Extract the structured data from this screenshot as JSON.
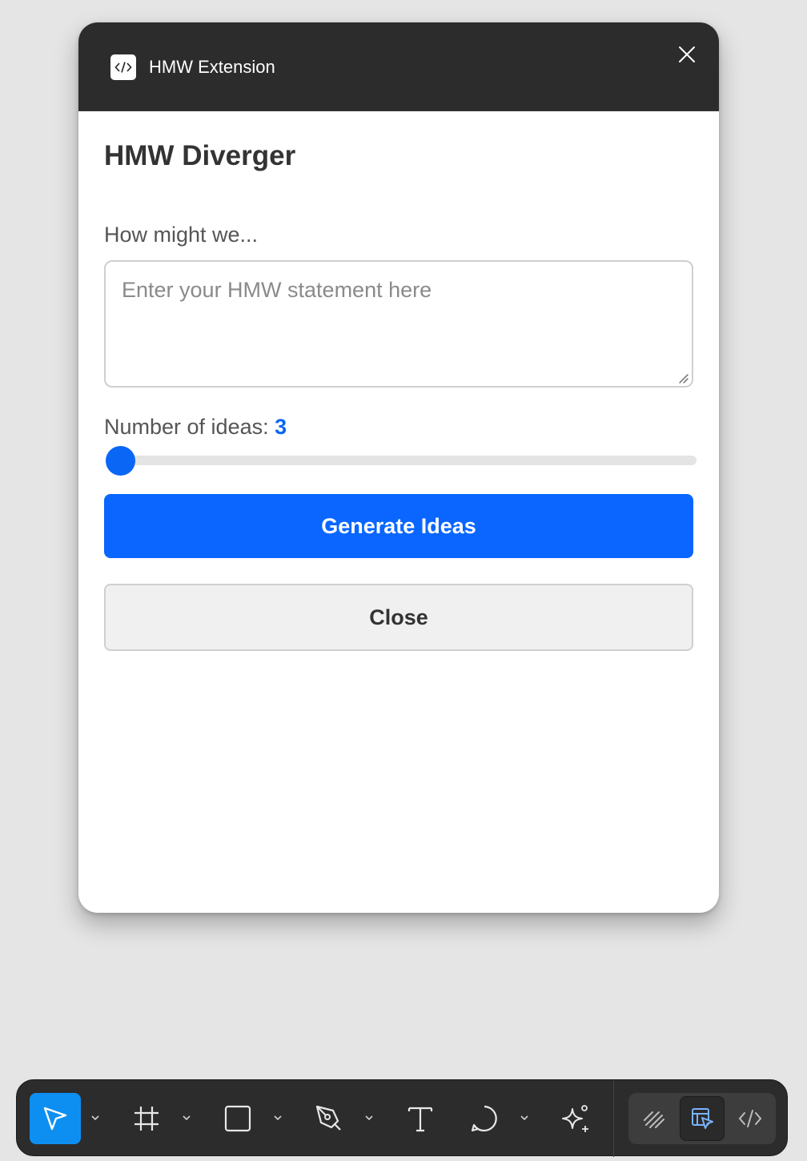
{
  "window": {
    "title": "HMW Extension",
    "app_icon": "code-brackets-icon",
    "close_icon": "close-icon"
  },
  "form": {
    "heading": "HMW Diverger",
    "hmw_label": "How might we...",
    "hmw_placeholder": "Enter your HMW statement here",
    "hmw_value": "",
    "ideas_label": "Number of ideas:",
    "ideas_count": "3",
    "slider_level": 0,
    "generate_label": "Generate Ideas",
    "close_label": "Close"
  },
  "toolbar": {
    "tools": [
      {
        "name": "move-tool",
        "icon": "cursor-arrow-icon",
        "active": true,
        "has_menu": true
      },
      {
        "name": "frame-tool",
        "icon": "frame-hash-icon",
        "active": false,
        "has_menu": true
      },
      {
        "name": "shape-tool",
        "icon": "rectangle-icon",
        "active": false,
        "has_menu": true
      },
      {
        "name": "pen-tool",
        "icon": "pen-nib-icon",
        "active": false,
        "has_menu": true
      },
      {
        "name": "text-tool",
        "icon": "text-t-icon",
        "active": false,
        "has_menu": false
      },
      {
        "name": "comment-tool",
        "icon": "speech-bubble-icon",
        "active": false,
        "has_menu": true
      },
      {
        "name": "actions-tool",
        "icon": "sparkle-icon",
        "active": false,
        "has_menu": false
      }
    ],
    "modes": [
      {
        "name": "draw-mode",
        "icon": "scribble-icon",
        "active": false
      },
      {
        "name": "design-mode",
        "icon": "design-cursor-icon",
        "active": true
      },
      {
        "name": "dev-mode",
        "icon": "code-brackets-icon",
        "active": false
      }
    ],
    "colors": {
      "active_tool": "#0d8ff2",
      "accent": "#0a66ff",
      "dev_mode_accent": "#7ab3ff"
    }
  }
}
